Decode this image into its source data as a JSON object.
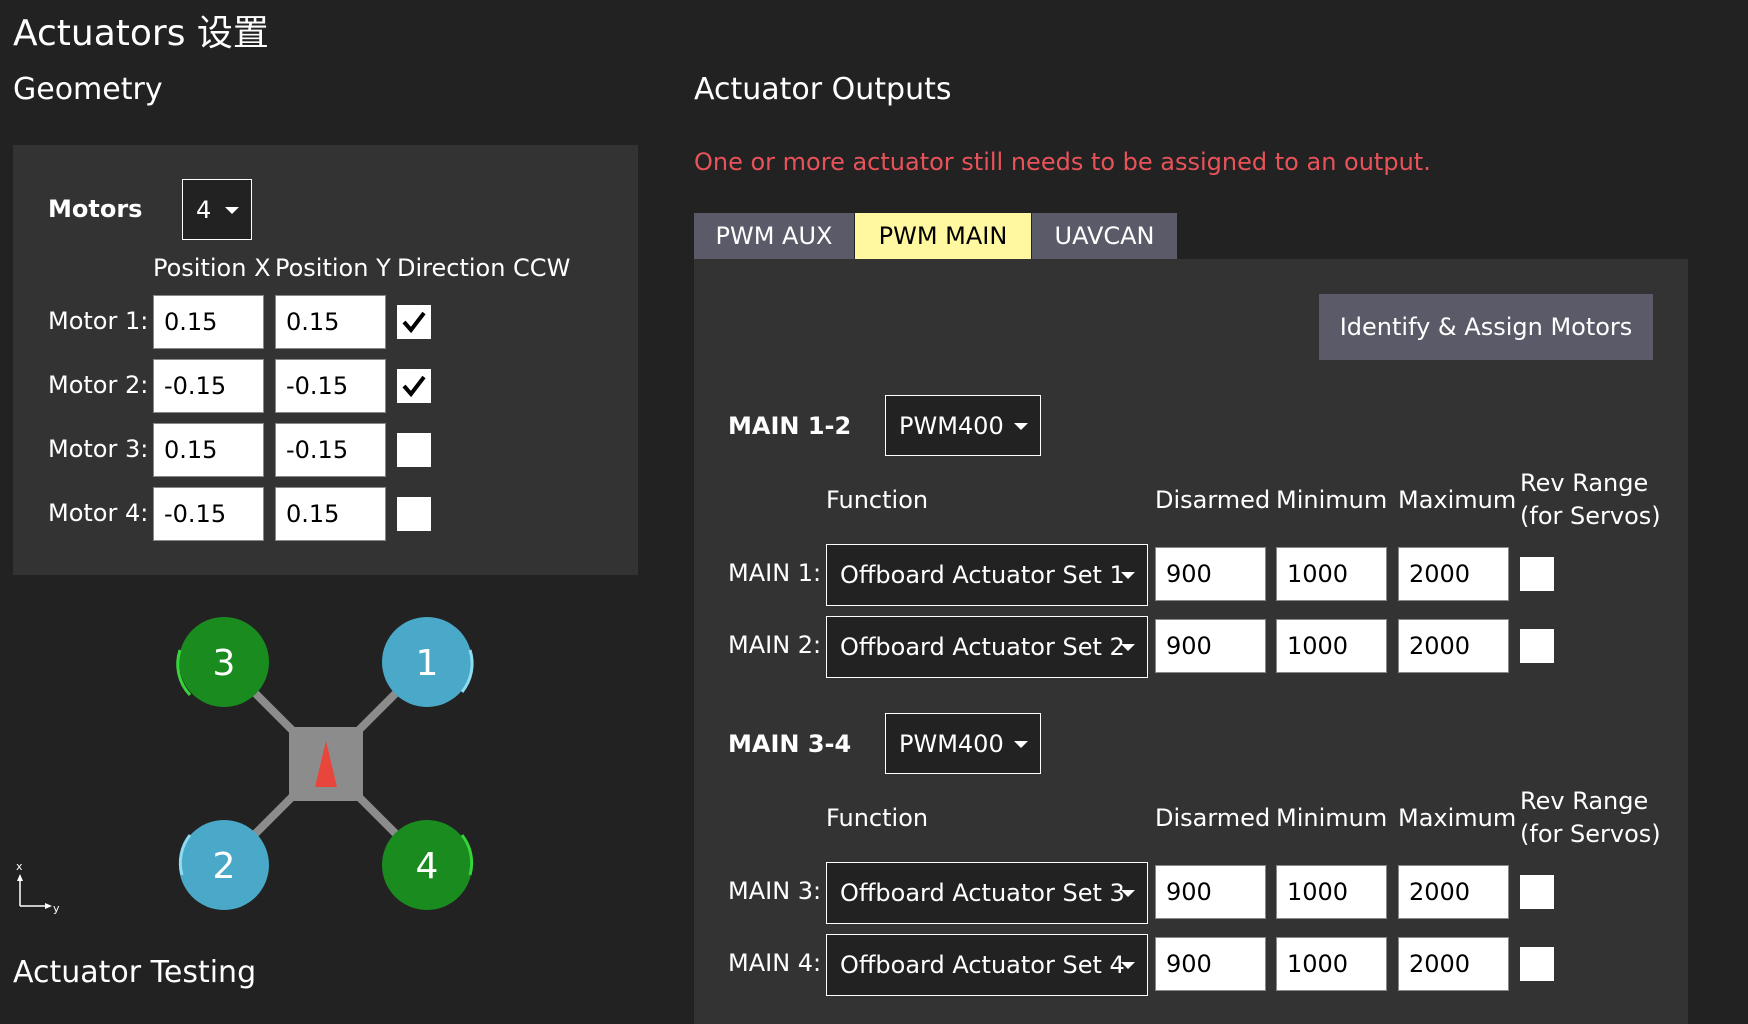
{
  "page": {
    "title": "Actuators 设置"
  },
  "geometry": {
    "heading": "Geometry",
    "motors_label": "Motors",
    "motors_count": "4",
    "col_x": "Position X",
    "col_y": "Position Y",
    "col_dir": "Direction CCW",
    "motors": [
      {
        "label": "Motor 1:",
        "x": "0.15",
        "y": "0.15",
        "ccw": true
      },
      {
        "label": "Motor 2:",
        "x": "-0.15",
        "y": "-0.15",
        "ccw": true
      },
      {
        "label": "Motor 3:",
        "x": "0.15",
        "y": "-0.15",
        "ccw": false
      },
      {
        "label": "Motor 4:",
        "x": "-0.15",
        "y": "0.15",
        "ccw": false
      }
    ],
    "diagram": {
      "rotors": [
        {
          "number": "3",
          "color": "#1a8c1f"
        },
        {
          "number": "1",
          "color": "#4aa8c9"
        },
        {
          "number": "2",
          "color": "#4aa8c9"
        },
        {
          "number": "4",
          "color": "#1a8c1f"
        }
      ],
      "axis_x": "x",
      "axis_y": "y",
      "body_color": "#8c8c8c",
      "arrow_color": "#e8453c"
    }
  },
  "testing": {
    "heading": "Actuator Testing"
  },
  "outputs": {
    "heading": "Actuator Outputs",
    "warning": "One or more actuator still needs to be assigned to an output.",
    "warning_color": "#e8535a",
    "tabs": [
      {
        "label": "PWM AUX",
        "active": false
      },
      {
        "label": "PWM MAIN",
        "active": true
      },
      {
        "label": "UAVCAN",
        "active": false
      }
    ],
    "identify_button": "Identify & Assign Motors",
    "col_function": "Function",
    "col_disarmed": "Disarmed",
    "col_minimum": "Minimum",
    "col_maximum": "Maximum",
    "col_rev_1": "Rev Range",
    "col_rev_2": "(for Servos)",
    "groups": [
      {
        "label": "MAIN 1-2",
        "protocol": "PWM400",
        "channels": [
          {
            "label": "MAIN 1:",
            "function": "Offboard Actuator Set 1",
            "disarmed": "900",
            "minimum": "1000",
            "maximum": "2000",
            "rev": false
          },
          {
            "label": "MAIN 2:",
            "function": "Offboard Actuator Set 2",
            "disarmed": "900",
            "minimum": "1000",
            "maximum": "2000",
            "rev": false
          }
        ]
      },
      {
        "label": "MAIN 3-4",
        "protocol": "PWM400",
        "channels": [
          {
            "label": "MAIN 3:",
            "function": "Offboard Actuator Set 3",
            "disarmed": "900",
            "minimum": "1000",
            "maximum": "2000",
            "rev": false
          },
          {
            "label": "MAIN 4:",
            "function": "Offboard Actuator Set 4",
            "disarmed": "900",
            "minimum": "1000",
            "maximum": "2000",
            "rev": false
          }
        ]
      }
    ]
  }
}
